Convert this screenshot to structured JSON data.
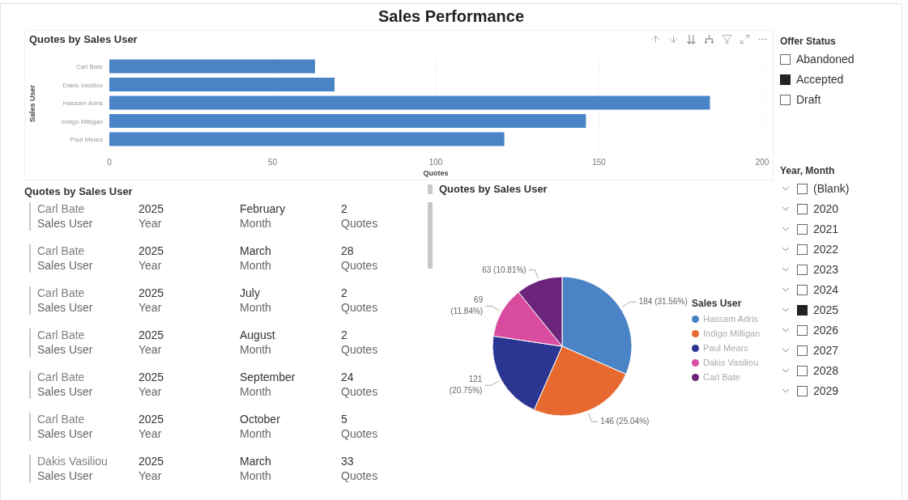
{
  "title": "Sales Performance",
  "bar_chart": {
    "title": "Quotes by Sales User",
    "chart_data": {
      "type": "bar",
      "orientation": "horizontal",
      "grid": true,
      "categories": [
        "Carl Bate",
        "Dakis Vasiliou",
        "Hassam Adris",
        "Indigo Milligan",
        "Paul Mears"
      ],
      "values": [
        63,
        69,
        184,
        146,
        121
      ],
      "xlabel": "Quotes",
      "ylabel": "Sales User",
      "xlim": [
        0,
        200
      ],
      "xticks": [
        0,
        50,
        100,
        150,
        200
      ]
    }
  },
  "table_card": {
    "title": "Quotes by Sales User",
    "rows": [
      {
        "cells": [
          {
            "value": "Carl Bate",
            "label": "Sales User"
          },
          {
            "value": "2025",
            "label": "Year"
          },
          {
            "value": "February",
            "label": "Month"
          },
          {
            "value": "2",
            "label": "Quotes"
          }
        ]
      },
      {
        "cells": [
          {
            "value": "Carl Bate",
            "label": "Sales User"
          },
          {
            "value": "2025",
            "label": "Year"
          },
          {
            "value": "March",
            "label": "Month"
          },
          {
            "value": "28",
            "label": "Quotes"
          }
        ]
      },
      {
        "cells": [
          {
            "value": "Carl Bate",
            "label": "Sales User"
          },
          {
            "value": "2025",
            "label": "Year"
          },
          {
            "value": "July",
            "label": "Month"
          },
          {
            "value": "2",
            "label": "Quotes"
          }
        ]
      },
      {
        "cells": [
          {
            "value": "Carl Bate",
            "label": "Sales User"
          },
          {
            "value": "2025",
            "label": "Year"
          },
          {
            "value": "August",
            "label": "Month"
          },
          {
            "value": "2",
            "label": "Quotes"
          }
        ]
      },
      {
        "cells": [
          {
            "value": "Carl Bate",
            "label": "Sales User"
          },
          {
            "value": "2025",
            "label": "Year"
          },
          {
            "value": "September",
            "label": "Month"
          },
          {
            "value": "24",
            "label": "Quotes"
          }
        ]
      },
      {
        "cells": [
          {
            "value": "Carl Bate",
            "label": "Sales User"
          },
          {
            "value": "2025",
            "label": "Year"
          },
          {
            "value": "October",
            "label": "Month"
          },
          {
            "value": "5",
            "label": "Quotes"
          }
        ]
      },
      {
        "cells": [
          {
            "value": "Dakis Vasiliou",
            "label": "Sales User"
          },
          {
            "value": "2025",
            "label": "Year"
          },
          {
            "value": "March",
            "label": "Month"
          },
          {
            "value": "33",
            "label": "Quotes"
          }
        ]
      }
    ]
  },
  "pie_chart": {
    "title": "Quotes by Sales User",
    "chart_data": {
      "type": "pie",
      "categories": [
        "Hassam Adris",
        "Indigo Milligan",
        "Paul Mears",
        "Dakis Vasiliou",
        "Carl Bate"
      ],
      "values": [
        184,
        146,
        121,
        69,
        63
      ],
      "value_labels": [
        "184 (31.56%)",
        "146 (25.04%)",
        "121 (20.75%)",
        "69 (11.84%)",
        "63 (10.81%)"
      ]
    },
    "legend": {
      "title": "Sales User",
      "items": [
        {
          "color": "#4a84c6"
        },
        {
          "color": "#e8692f"
        },
        {
          "color": "#2b3692"
        },
        {
          "color": "#d94b9f"
        },
        {
          "color": "#6b2479"
        }
      ]
    }
  },
  "offer_status": {
    "title": "Offer Status",
    "items": [
      {
        "label": "Abandoned",
        "checked": false
      },
      {
        "label": "Accepted",
        "checked": true
      },
      {
        "label": "Draft",
        "checked": false
      }
    ]
  },
  "year_month": {
    "title": "Year, Month",
    "items": [
      {
        "label": "(Blank)",
        "checked": false
      },
      {
        "label": "2020",
        "checked": false
      },
      {
        "label": "2021",
        "checked": false
      },
      {
        "label": "2022",
        "checked": false
      },
      {
        "label": "2023",
        "checked": false
      },
      {
        "label": "2024",
        "checked": false
      },
      {
        "label": "2025",
        "checked": true
      },
      {
        "label": "2026",
        "checked": false
      },
      {
        "label": "2027",
        "checked": false
      },
      {
        "label": "2028",
        "checked": false
      },
      {
        "label": "2029",
        "checked": false
      }
    ]
  }
}
